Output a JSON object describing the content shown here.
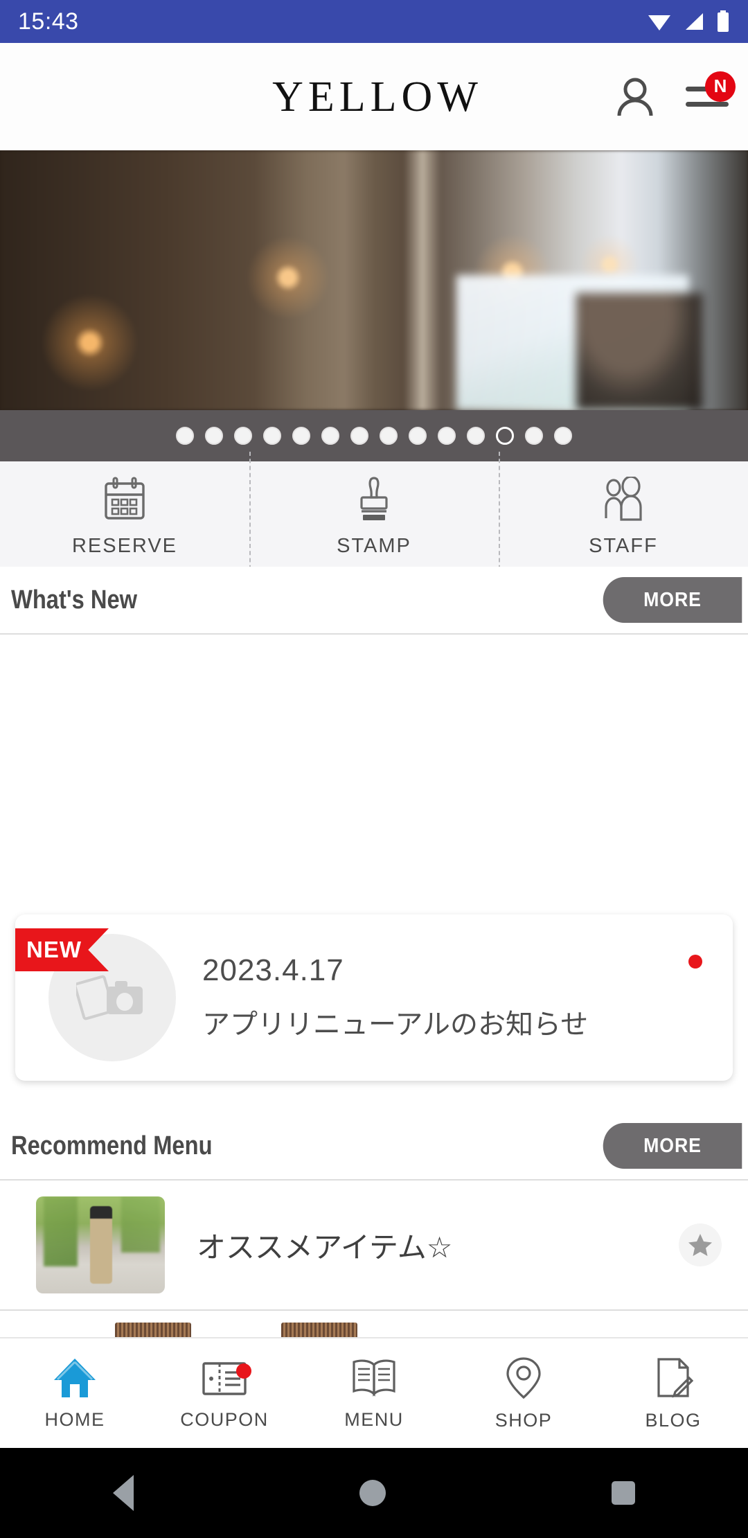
{
  "status_bar": {
    "time": "15:43",
    "icons": [
      "wifi-icon",
      "cellular-signal-icon",
      "battery-icon"
    ],
    "background_color": "#3949ab"
  },
  "app_header": {
    "brand": "YELLOW",
    "account_icon": "person-icon",
    "menu_icon": "hamburger-menu-icon",
    "menu_badge": "N",
    "badge_color": "#e30613"
  },
  "hero_carousel": {
    "total_slides": 14,
    "active_slide": 12,
    "indicator_background": "#5b5759"
  },
  "quick_menu": [
    {
      "label": "RESERVE",
      "icon": "calendar-icon"
    },
    {
      "label": "STAMP",
      "icon": "stamp-icon"
    },
    {
      "label": "STAFF",
      "icon": "people-icon"
    }
  ],
  "whats_new": {
    "title": "What's New",
    "more_label": "MORE",
    "items": [
      {
        "ribbon": "NEW",
        "date": "2023.4.17",
        "title": "アプリリニューアルのお知らせ",
        "thumbnail_icon": "photo-placeholder-icon",
        "unread_dot_color": "#e8161b"
      }
    ]
  },
  "recommend_menu": {
    "title": "Recommend Menu",
    "more_label": "MORE",
    "items": [
      {
        "title": "オススメアイテム☆",
        "thumbnail_icon": "product-photo",
        "favorite_icon": "star-icon"
      }
    ]
  },
  "bottom_nav": {
    "active_color": "#1a9ad7",
    "items": [
      {
        "label": "HOME",
        "icon": "home-icon",
        "active": true,
        "badge": false
      },
      {
        "label": "COUPON",
        "icon": "coupon-icon",
        "active": false,
        "badge": true
      },
      {
        "label": "MENU",
        "icon": "book-icon",
        "active": false,
        "badge": false
      },
      {
        "label": "SHOP",
        "icon": "map-pin-icon",
        "active": false,
        "badge": false
      },
      {
        "label": "BLOG",
        "icon": "document-pencil-icon",
        "active": false,
        "badge": false
      }
    ]
  },
  "android_nav": {
    "back": "back-triangle-icon",
    "home": "home-circle-icon",
    "recents": "recents-square-icon"
  }
}
